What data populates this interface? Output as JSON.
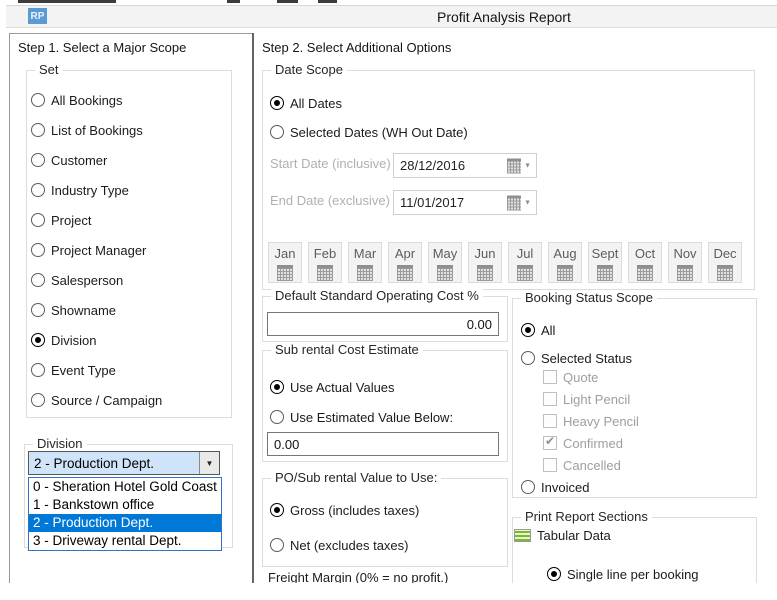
{
  "window": {
    "icon": "RP",
    "title": "Profit Analysis Report"
  },
  "step1": {
    "header": "Step 1. Select a Major Scope",
    "set": {
      "label": "Set",
      "selected": "Division",
      "options": [
        "All Bookings",
        "List of Bookings",
        "Customer",
        "Industry Type",
        "Project",
        "Project Manager",
        "Salesperson",
        "Showname",
        "Division",
        "Event Type",
        "Source / Campaign"
      ]
    },
    "division": {
      "label": "Division",
      "value": "2 - Production Dept.",
      "dropdown_arrow": "▼",
      "highlighted": "2 - Production Dept.",
      "options": [
        "0 - Sheration Hotel Gold Coast",
        "1 - Bankstown office",
        "2 - Production Dept.",
        "3 - Driveway rental Dept."
      ]
    }
  },
  "step2": {
    "header": "Step 2. Select Additional Options",
    "date_scope": {
      "label": "Date Scope",
      "selected": "All Dates",
      "all_dates": "All Dates",
      "selected_dates": "Selected Dates (WH Out Date)",
      "start_label": "Start Date (inclusive)",
      "start_value": "28/12/2016",
      "end_label": "End Date (exclusive)",
      "end_value": "11/01/2017",
      "dropdown_arrow": "▼",
      "months": [
        "Jan",
        "Feb",
        "Mar",
        "Apr",
        "May",
        "Jun",
        "Jul",
        "Aug",
        "Sept",
        "Oct",
        "Nov",
        "Dec"
      ]
    },
    "operating_cost": {
      "label": "Default Standard Operating Cost %",
      "value": "0.00"
    },
    "sub_rental": {
      "label": "Sub rental Cost Estimate",
      "selected": "Use Actual Values",
      "use_actual": "Use Actual Values",
      "use_estimated": "Use Estimated Value Below:",
      "value": "0.00"
    },
    "po_value": {
      "label": "PO/Sub rental Value to Use:",
      "selected": "Gross (includes taxes)",
      "gross": "Gross (includes taxes)",
      "net": "Net (excludes taxes)"
    },
    "freight": {
      "label_partial": "Freight Margin (0% = no profit.)"
    },
    "booking_status": {
      "label": "Booking Status Scope",
      "selected": "All",
      "all": "All",
      "selected_status": "Selected Status",
      "statuses": [
        {
          "label": "Quote",
          "checked": false
        },
        {
          "label": "Light Pencil",
          "checked": false
        },
        {
          "label": "Heavy Pencil",
          "checked": false
        },
        {
          "label": "Confirmed",
          "checked": true
        },
        {
          "label": "Cancelled",
          "checked": false
        }
      ],
      "invoiced": "Invoiced"
    },
    "print_sections": {
      "label": "Print Report Sections",
      "tabular": "Tabular Data",
      "selected": "Single line per booking",
      "single_line": "Single line per booking"
    }
  }
}
